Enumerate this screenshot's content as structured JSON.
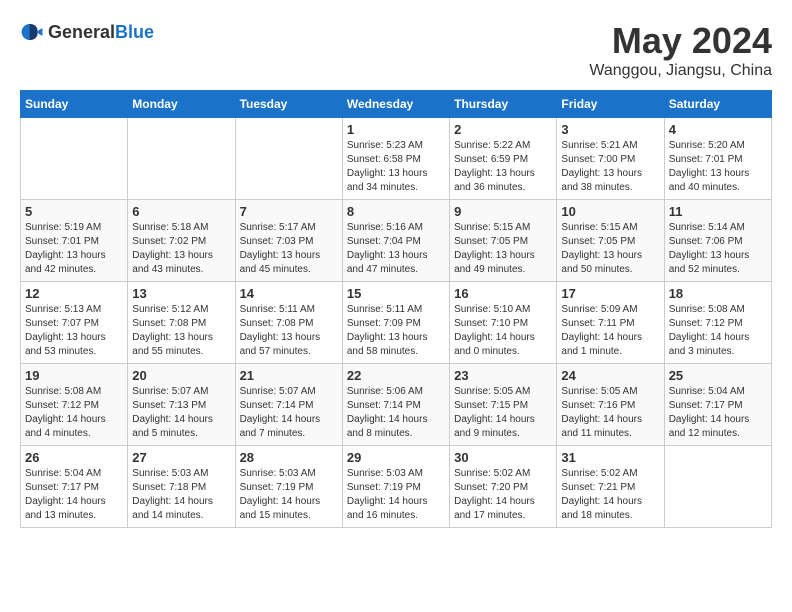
{
  "header": {
    "logo_general": "General",
    "logo_blue": "Blue",
    "month_year": "May 2024",
    "location": "Wanggou, Jiangsu, China"
  },
  "weekdays": [
    "Sunday",
    "Monday",
    "Tuesday",
    "Wednesday",
    "Thursday",
    "Friday",
    "Saturday"
  ],
  "weeks": [
    [
      {
        "day": "",
        "info": ""
      },
      {
        "day": "",
        "info": ""
      },
      {
        "day": "",
        "info": ""
      },
      {
        "day": "1",
        "info": "Sunrise: 5:23 AM\nSunset: 6:58 PM\nDaylight: 13 hours\nand 34 minutes."
      },
      {
        "day": "2",
        "info": "Sunrise: 5:22 AM\nSunset: 6:59 PM\nDaylight: 13 hours\nand 36 minutes."
      },
      {
        "day": "3",
        "info": "Sunrise: 5:21 AM\nSunset: 7:00 PM\nDaylight: 13 hours\nand 38 minutes."
      },
      {
        "day": "4",
        "info": "Sunrise: 5:20 AM\nSunset: 7:01 PM\nDaylight: 13 hours\nand 40 minutes."
      }
    ],
    [
      {
        "day": "5",
        "info": "Sunrise: 5:19 AM\nSunset: 7:01 PM\nDaylight: 13 hours\nand 42 minutes."
      },
      {
        "day": "6",
        "info": "Sunrise: 5:18 AM\nSunset: 7:02 PM\nDaylight: 13 hours\nand 43 minutes."
      },
      {
        "day": "7",
        "info": "Sunrise: 5:17 AM\nSunset: 7:03 PM\nDaylight: 13 hours\nand 45 minutes."
      },
      {
        "day": "8",
        "info": "Sunrise: 5:16 AM\nSunset: 7:04 PM\nDaylight: 13 hours\nand 47 minutes."
      },
      {
        "day": "9",
        "info": "Sunrise: 5:15 AM\nSunset: 7:05 PM\nDaylight: 13 hours\nand 49 minutes."
      },
      {
        "day": "10",
        "info": "Sunrise: 5:15 AM\nSunset: 7:05 PM\nDaylight: 13 hours\nand 50 minutes."
      },
      {
        "day": "11",
        "info": "Sunrise: 5:14 AM\nSunset: 7:06 PM\nDaylight: 13 hours\nand 52 minutes."
      }
    ],
    [
      {
        "day": "12",
        "info": "Sunrise: 5:13 AM\nSunset: 7:07 PM\nDaylight: 13 hours\nand 53 minutes."
      },
      {
        "day": "13",
        "info": "Sunrise: 5:12 AM\nSunset: 7:08 PM\nDaylight: 13 hours\nand 55 minutes."
      },
      {
        "day": "14",
        "info": "Sunrise: 5:11 AM\nSunset: 7:08 PM\nDaylight: 13 hours\nand 57 minutes."
      },
      {
        "day": "15",
        "info": "Sunrise: 5:11 AM\nSunset: 7:09 PM\nDaylight: 13 hours\nand 58 minutes."
      },
      {
        "day": "16",
        "info": "Sunrise: 5:10 AM\nSunset: 7:10 PM\nDaylight: 14 hours\nand 0 minutes."
      },
      {
        "day": "17",
        "info": "Sunrise: 5:09 AM\nSunset: 7:11 PM\nDaylight: 14 hours\nand 1 minute."
      },
      {
        "day": "18",
        "info": "Sunrise: 5:08 AM\nSunset: 7:12 PM\nDaylight: 14 hours\nand 3 minutes."
      }
    ],
    [
      {
        "day": "19",
        "info": "Sunrise: 5:08 AM\nSunset: 7:12 PM\nDaylight: 14 hours\nand 4 minutes."
      },
      {
        "day": "20",
        "info": "Sunrise: 5:07 AM\nSunset: 7:13 PM\nDaylight: 14 hours\nand 5 minutes."
      },
      {
        "day": "21",
        "info": "Sunrise: 5:07 AM\nSunset: 7:14 PM\nDaylight: 14 hours\nand 7 minutes."
      },
      {
        "day": "22",
        "info": "Sunrise: 5:06 AM\nSunset: 7:14 PM\nDaylight: 14 hours\nand 8 minutes."
      },
      {
        "day": "23",
        "info": "Sunrise: 5:05 AM\nSunset: 7:15 PM\nDaylight: 14 hours\nand 9 minutes."
      },
      {
        "day": "24",
        "info": "Sunrise: 5:05 AM\nSunset: 7:16 PM\nDaylight: 14 hours\nand 11 minutes."
      },
      {
        "day": "25",
        "info": "Sunrise: 5:04 AM\nSunset: 7:17 PM\nDaylight: 14 hours\nand 12 minutes."
      }
    ],
    [
      {
        "day": "26",
        "info": "Sunrise: 5:04 AM\nSunset: 7:17 PM\nDaylight: 14 hours\nand 13 minutes."
      },
      {
        "day": "27",
        "info": "Sunrise: 5:03 AM\nSunset: 7:18 PM\nDaylight: 14 hours\nand 14 minutes."
      },
      {
        "day": "28",
        "info": "Sunrise: 5:03 AM\nSunset: 7:19 PM\nDaylight: 14 hours\nand 15 minutes."
      },
      {
        "day": "29",
        "info": "Sunrise: 5:03 AM\nSunset: 7:19 PM\nDaylight: 14 hours\nand 16 minutes."
      },
      {
        "day": "30",
        "info": "Sunrise: 5:02 AM\nSunset: 7:20 PM\nDaylight: 14 hours\nand 17 minutes."
      },
      {
        "day": "31",
        "info": "Sunrise: 5:02 AM\nSunset: 7:21 PM\nDaylight: 14 hours\nand 18 minutes."
      },
      {
        "day": "",
        "info": ""
      }
    ]
  ]
}
